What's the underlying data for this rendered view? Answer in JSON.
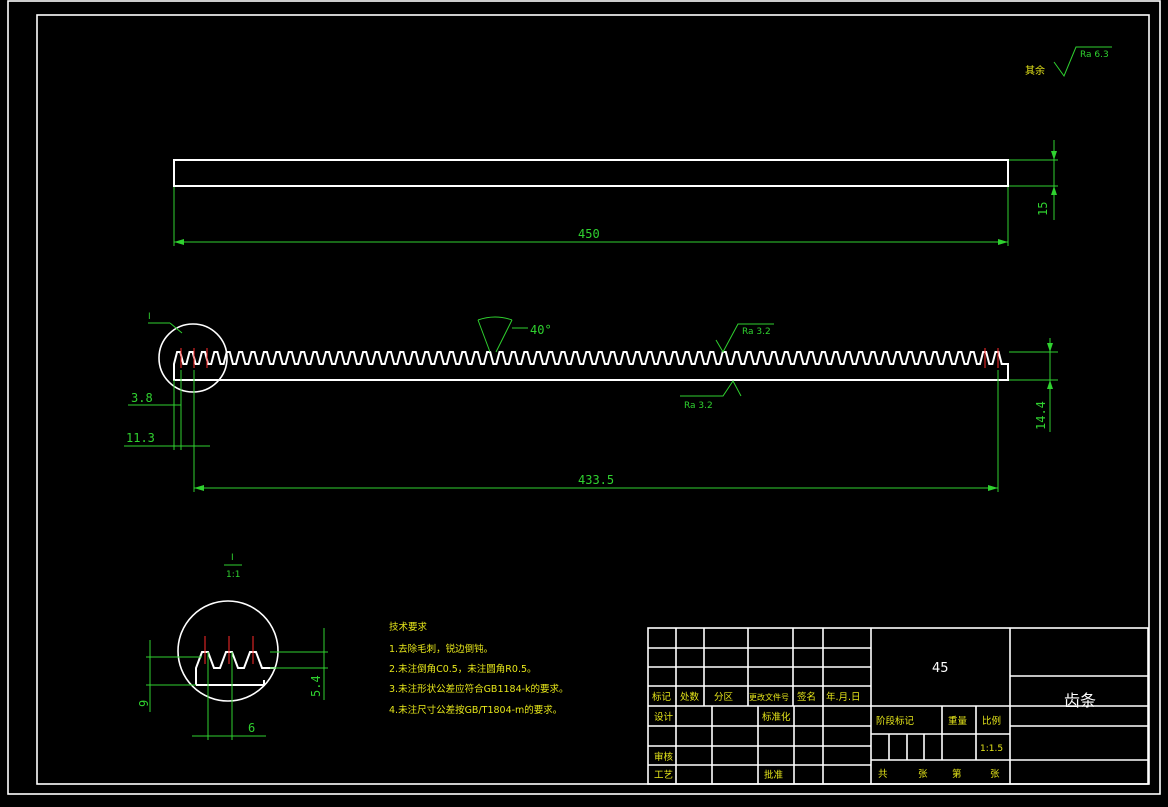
{
  "surface_finish": {
    "other_label": "其余",
    "other_ra": "Ra 6.3",
    "top_ra": "Ra 3.2",
    "bottom_ra": "Ra 3.2"
  },
  "dimensions": {
    "top_length": "450",
    "top_height": "15",
    "tooth_angle": "40°",
    "rack_height": "14.4",
    "offset_1": "3.8",
    "offset_2": "11.3",
    "teeth_length": "433.5",
    "detail_height": "9",
    "detail_tooth_depth": "5.4",
    "detail_width": "6"
  },
  "detail_callout": {
    "marker": "I",
    "label_num": "I",
    "label_scale": "1:1"
  },
  "tech_requirements": {
    "title": "技术要求",
    "items": [
      "1.去除毛刺，锐边倒钝。",
      "2.未注倒角C0.5，未注圆角R0.5。",
      "3.未注形状公差应符合GB1184-k的要求。",
      "4.未注尺寸公差按GB/T1804-m的要求。"
    ]
  },
  "title_block": {
    "material": "45",
    "part_name": "齿条",
    "header_cells": [
      "标记",
      "处数",
      "分区",
      "更改文件号",
      "签名",
      "年.月.日"
    ],
    "design_label": "设计",
    "standard_label": "标准化",
    "review_label": "审核",
    "process_label": "工艺",
    "approve_label": "批准",
    "stage_label": "阶段标记",
    "weight_label": "重量",
    "scale_label": "比例",
    "scale_value": "1:1.5",
    "sheet_total": "共",
    "sheet_unit_1": "张",
    "sheet_of": "第",
    "sheet_unit_2": "张"
  }
}
